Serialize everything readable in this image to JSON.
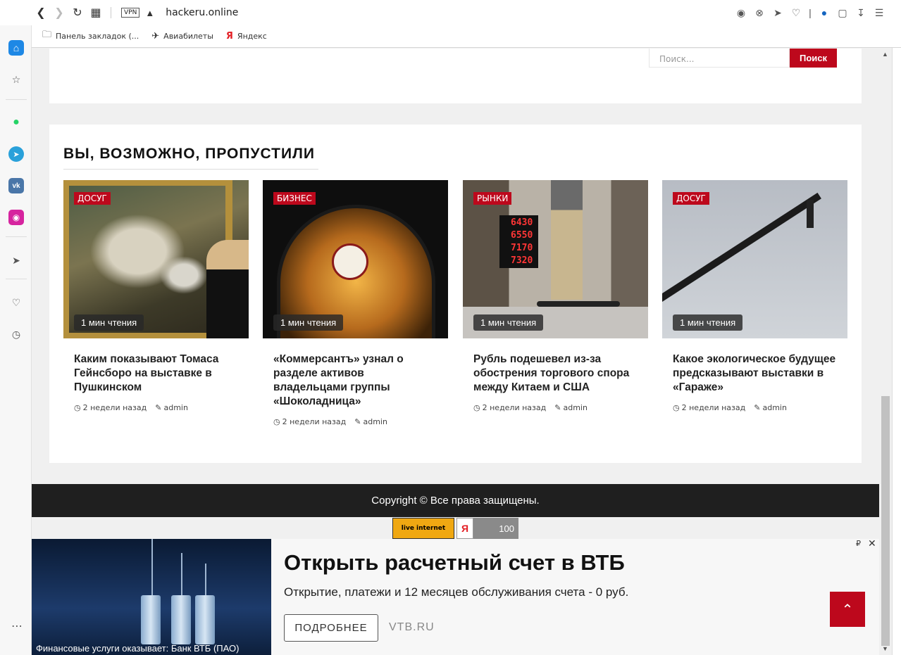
{
  "browser": {
    "vpn_label": "VPN",
    "url": "hackeru.online",
    "bookmarks": [
      {
        "label": "Панель закладок (...",
        "icon": "folder-icon"
      },
      {
        "label": "Авиабилеты",
        "icon": "plane-icon"
      },
      {
        "label": "Яндекс",
        "icon": "yandex-icon"
      }
    ]
  },
  "search": {
    "placeholder": "Поиск...",
    "button_label": "Поиск"
  },
  "missed": {
    "title": "ВЫ, ВОЗМОЖНО, ПРОПУСТИЛИ",
    "cards": [
      {
        "category": "ДОСУГ",
        "read_time": "1 мин чтения",
        "title": "Каким показывают Томаса Гейнсборо на выставке в Пушкинском",
        "date": "2 недели назад",
        "author": "admin"
      },
      {
        "category": "БИЗНЕС",
        "read_time": "1 мин чтения",
        "title": "«Коммерсантъ» узнал о разделе активов владельцами группы «Шоколадница»",
        "date": "2 недели назад",
        "author": "admin"
      },
      {
        "category": "РЫНКИ",
        "read_time": "1 мин чтения",
        "title": "Рубль подешевел из-за обострения торгового спора между Китаем и США",
        "date": "2 недели назад",
        "author": "admin"
      },
      {
        "category": "ДОСУГ",
        "read_time": "1 мин чтения",
        "title": "Какое экологическое будущее предсказывают выставки в «Гараже»",
        "date": "2 недели назад",
        "author": "admin"
      }
    ],
    "board_numbers": [
      "6430",
      "6550",
      "7170",
      "7320"
    ]
  },
  "footer": {
    "copyright": "Copyright © Все права защищены."
  },
  "counters": {
    "liveinternet_label": "live internet",
    "yandex_value": "100"
  },
  "ad": {
    "title": "Открыть расчетный счет в ВТБ",
    "text": "Открытие, платежи и 12 месяцев обслуживания счета - 0 руб.",
    "button_label": "ПОДРОБНЕЕ",
    "domain": "VTB.RU",
    "caption": "Финансовые услуги оказывает: Банк ВТБ (ПАО)",
    "ruble": "₽"
  },
  "colors": {
    "accent": "#bd081c",
    "footer": "#1f1f1f"
  }
}
